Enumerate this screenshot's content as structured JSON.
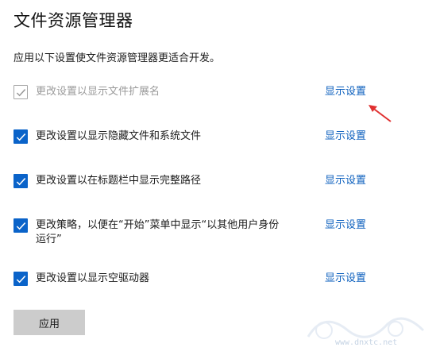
{
  "page": {
    "title": "文件资源管理器",
    "subtitle": "应用以下设置使文件资源管理器更适合开发。"
  },
  "settings": [
    {
      "label": "更改设置以显示文件扩展名",
      "link": "显示设置",
      "checked": true,
      "disabled": true
    },
    {
      "label": "更改设置以显示隐藏文件和系统文件",
      "link": "显示设置",
      "checked": true,
      "disabled": false
    },
    {
      "label": "更改设置以在标题栏中显示完整路径",
      "link": "显示设置",
      "checked": true,
      "disabled": false
    },
    {
      "label": "更改策略，以便在“开始”菜单中显示“以其他用户身份运行”",
      "link": "显示设置",
      "checked": true,
      "disabled": false
    },
    {
      "label": "更改设置以显示空驱动器",
      "link": "显示设置",
      "checked": true,
      "disabled": false
    }
  ],
  "apply_button": {
    "label": "应用"
  },
  "watermark": {
    "text": "www.dnxtc.net"
  },
  "colors": {
    "accent": "#0a63c9",
    "link": "#0a5ebd",
    "arrow": "#e03030",
    "button_bg": "#cccccc"
  },
  "icons": {
    "checkbox_mark": "checkmark-icon",
    "annotation": "red-arrow-icon"
  }
}
